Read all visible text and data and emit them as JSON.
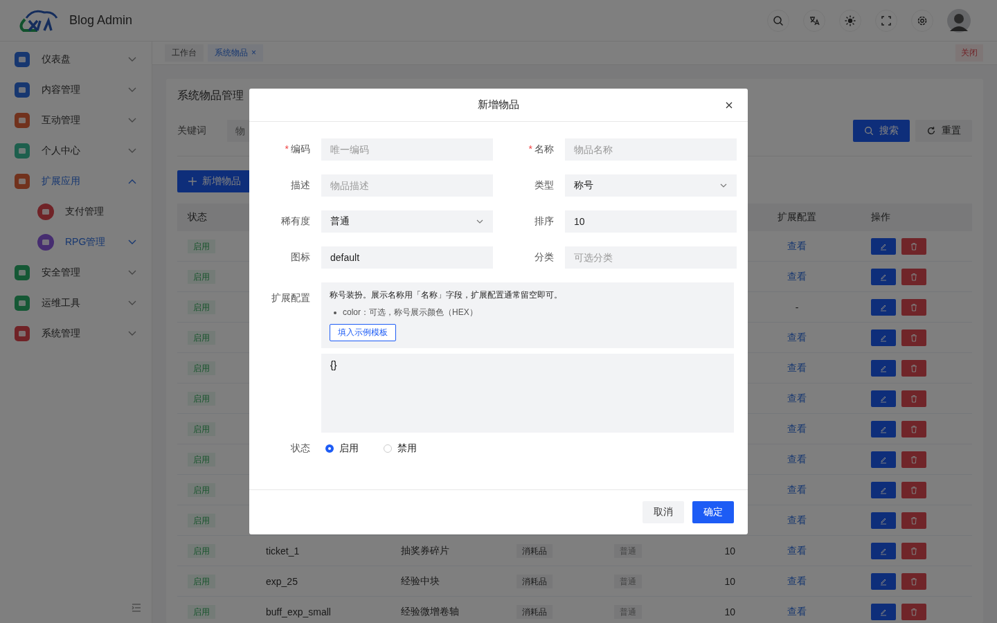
{
  "header": {
    "title": "Blog Admin"
  },
  "sidebar": {
    "items": [
      {
        "label": "仪表盘",
        "kind": "group",
        "active": false,
        "expanded": false
      },
      {
        "label": "内容管理",
        "kind": "group",
        "active": false,
        "expanded": false
      },
      {
        "label": "互动管理",
        "kind": "group",
        "active": false,
        "expanded": false
      },
      {
        "label": "个人中心",
        "kind": "group",
        "active": false,
        "expanded": false
      },
      {
        "label": "扩展应用",
        "kind": "group",
        "active": true,
        "expanded": true,
        "children": [
          {
            "label": "支付管理",
            "kind": "link",
            "active": false
          },
          {
            "label": "RPG管理",
            "kind": "group",
            "active": true,
            "expanded": false
          }
        ]
      },
      {
        "label": "安全管理",
        "kind": "group",
        "active": false,
        "expanded": false
      },
      {
        "label": "运维工具",
        "kind": "group",
        "active": false,
        "expanded": false
      },
      {
        "label": "系统管理",
        "kind": "group",
        "active": false,
        "expanded": false
      }
    ]
  },
  "tabs": [
    {
      "label": "工作台",
      "selected": false
    },
    {
      "label": "系统物品",
      "selected": true,
      "close_mark": "×"
    }
  ],
  "close_all": "关闭",
  "page": {
    "title": "系统物品管理",
    "filter_label": "关键词",
    "filter_placeholder": "物",
    "search": "搜索",
    "reset": "重置",
    "add": "新增物品"
  },
  "table": {
    "headers": {
      "status": "状态",
      "ext": "扩展配置",
      "actions": "操作"
    },
    "rows": [
      {
        "status": "启用",
        "ext": "查看",
        "ext_link": true
      },
      {
        "status": "启用",
        "ext": "查看",
        "ext_link": true
      },
      {
        "status": "启用",
        "ext": "-",
        "ext_link": false
      },
      {
        "status": "启用",
        "ext": "查看",
        "ext_link": true
      },
      {
        "status": "启用",
        "ext": "查看",
        "ext_link": true
      },
      {
        "status": "启用",
        "ext": "查看",
        "ext_link": true
      },
      {
        "status": "启用",
        "ext": "查看",
        "ext_link": true
      },
      {
        "status": "启用",
        "ext": "查看",
        "ext_link": true
      },
      {
        "status": "启用",
        "ext": "查看",
        "ext_link": true
      },
      {
        "status": "启用",
        "ext": "查看",
        "ext_link": true
      },
      {
        "status": "启用",
        "code": "ticket_1",
        "name": "抽奖券碎片",
        "type": "消耗品",
        "rarity": "普通",
        "sort": "10",
        "ext": "查看",
        "ext_link": true
      },
      {
        "status": "启用",
        "code": "exp_25",
        "name": "经验中块",
        "type": "消耗品",
        "rarity": "普通",
        "sort": "10",
        "ext": "查看",
        "ext_link": true
      },
      {
        "status": "启用",
        "code": "buff_exp_small",
        "name": "经验微增卷轴",
        "type": "消耗品",
        "rarity": "普通",
        "sort": "10",
        "ext": "查看",
        "ext_link": true
      }
    ]
  },
  "dialog": {
    "title": "新增物品",
    "fields": [
      {
        "label": "编码",
        "required_mark": "*",
        "kind": "input",
        "placeholder": "唯一编码"
      },
      {
        "label": "名称",
        "required_mark": "*",
        "kind": "input",
        "placeholder": "物品名称"
      },
      {
        "label": "描述",
        "kind": "input",
        "placeholder": "物品描述"
      },
      {
        "label": "类型",
        "kind": "select",
        "value": "称号"
      },
      {
        "label": "稀有度",
        "kind": "select",
        "value": "普通"
      },
      {
        "label": "排序",
        "kind": "input",
        "value": "10"
      },
      {
        "label": "图标",
        "kind": "input",
        "value": "default"
      },
      {
        "label": "分类",
        "kind": "input",
        "placeholder": "可选分类"
      }
    ],
    "ext": {
      "label": "扩展配置",
      "hint": "称号装扮。展示名称用「名称」字段，扩展配置通常留空即可。",
      "bullets": [
        "color：可选，称号展示颜色（HEX）"
      ],
      "template_button": "填入示例模板",
      "value": "{}"
    },
    "status": {
      "label": "状态",
      "options": [
        {
          "label": "启用",
          "selected": true
        },
        {
          "label": "禁用",
          "selected": false
        }
      ]
    },
    "buttons": [
      {
        "label": "取消",
        "kind": "secondary"
      },
      {
        "label": "确定",
        "kind": "primary"
      }
    ]
  }
}
